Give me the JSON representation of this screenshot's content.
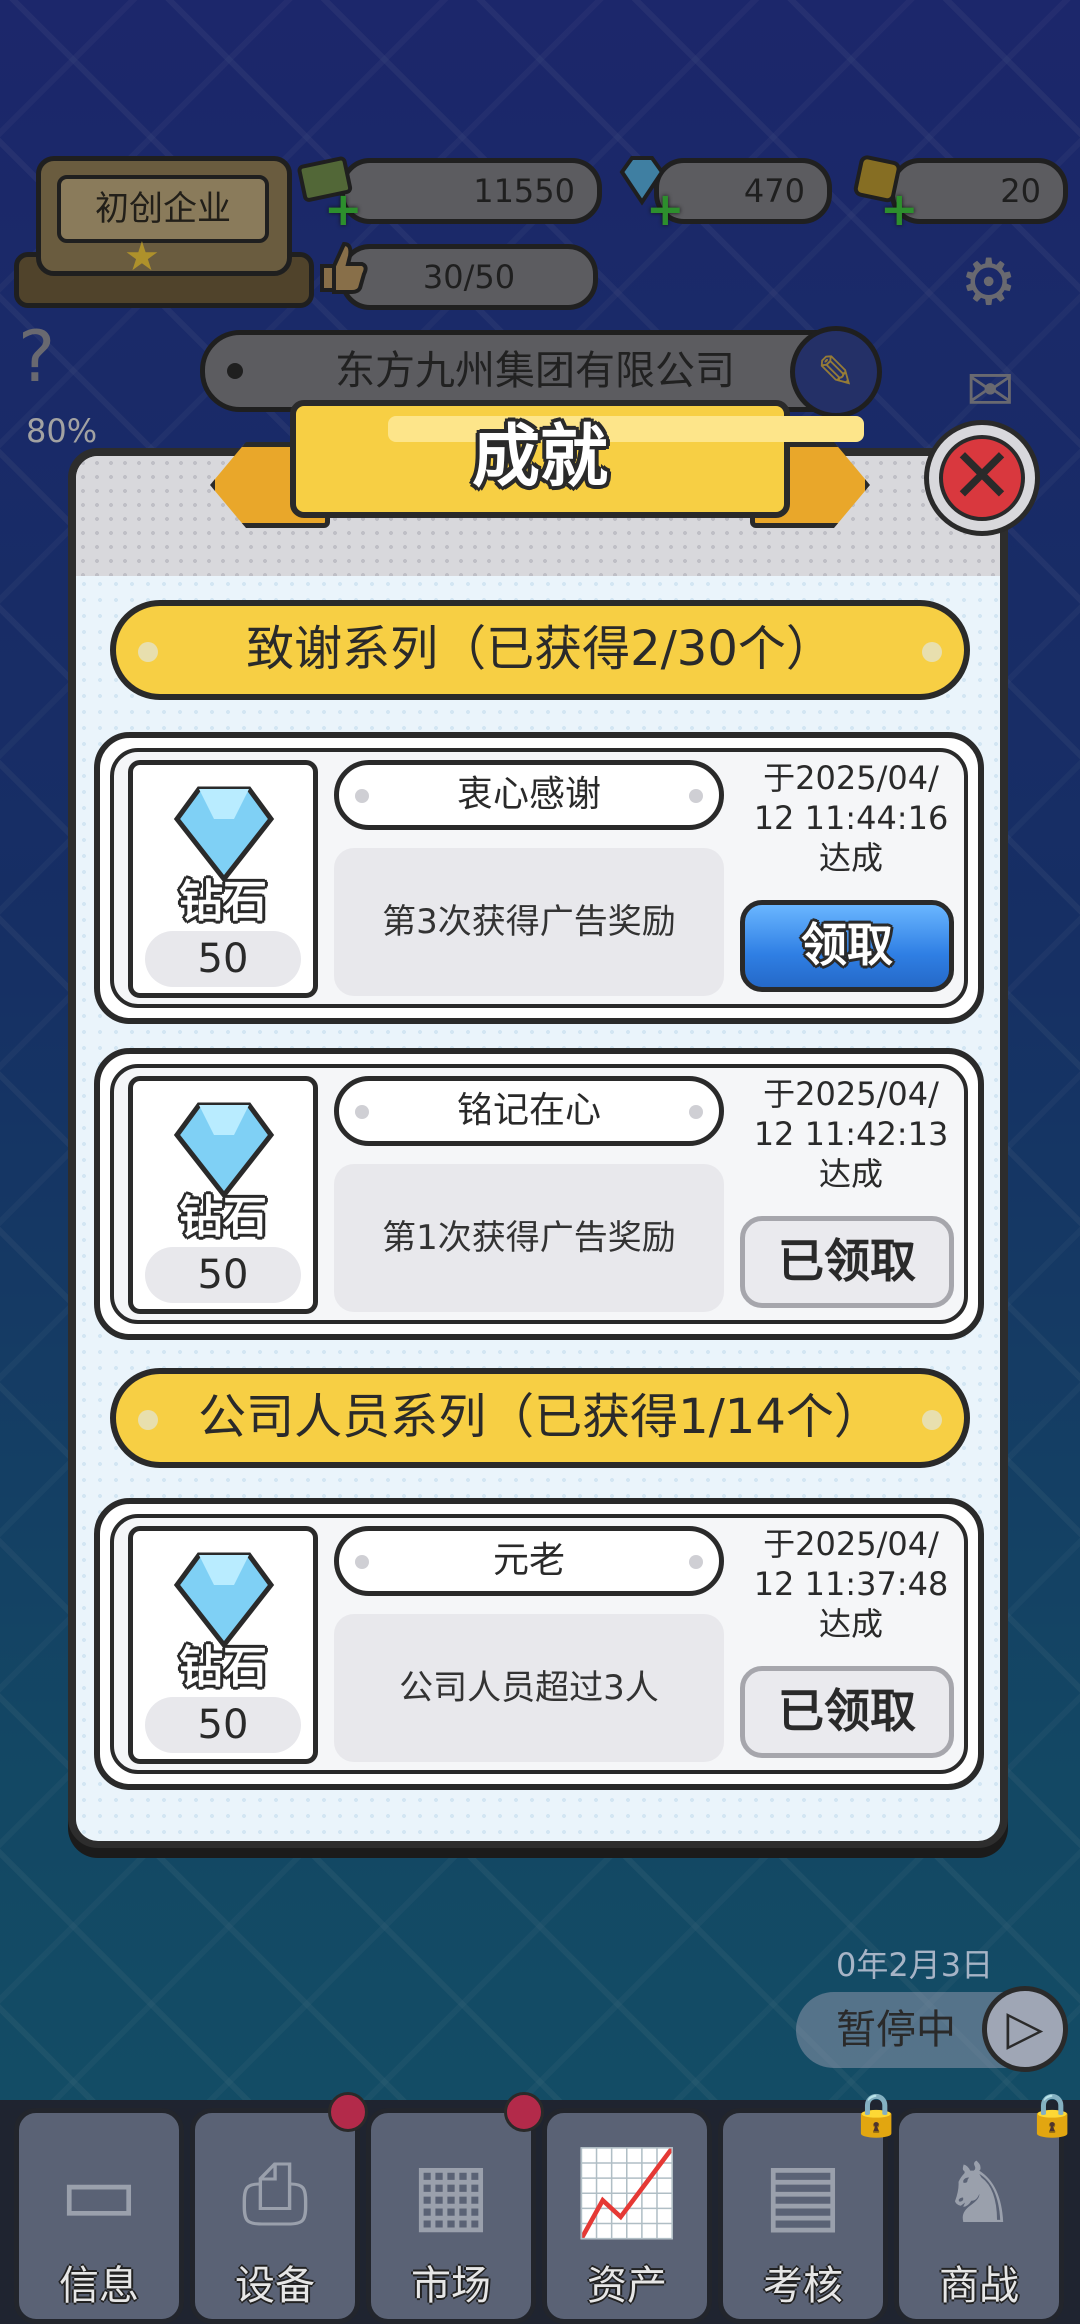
{
  "hud": {
    "company_level": "初创企业",
    "money": "11550",
    "diamonds": "470",
    "tickets": "20",
    "likes": "30/50",
    "company_name": "东方九州集团有限公司",
    "help_percent": "80%"
  },
  "modal": {
    "title": "成就",
    "sections": [
      {
        "heading": "致谢系列（已获得2/30个）",
        "items": [
          {
            "reward_name": "钻石",
            "reward_amount": "50",
            "title": "衷心感谢",
            "description": "第3次获得广告奖励",
            "date_line1": "于2025/04/",
            "date_line2": "12 11:44:16",
            "date_line3": "达成",
            "button": "领取",
            "button_state": "claimable"
          },
          {
            "reward_name": "钻石",
            "reward_amount": "50",
            "title": "铭记在心",
            "description": "第1次获得广告奖励",
            "date_line1": "于2025/04/",
            "date_line2": "12 11:42:13",
            "date_line3": "达成",
            "button": "已领取",
            "button_state": "claimed"
          }
        ]
      },
      {
        "heading": "公司人员系列（已获得1/14个）",
        "items": [
          {
            "reward_name": "钻石",
            "reward_amount": "50",
            "title": "元老",
            "description": "公司人员超过3人",
            "date_line1": "于2025/04/",
            "date_line2": "12 11:37:48",
            "date_line3": "达成",
            "button": "已领取",
            "button_state": "claimed"
          }
        ]
      }
    ]
  },
  "game_date": "0年2月3日",
  "pause_label": "暂停中",
  "nav": [
    "信息",
    "设备",
    "市场",
    "资产",
    "考核",
    "商战"
  ],
  "colors": {
    "accent_yellow": "#f7cf44",
    "claim_blue": "#2f7fe4",
    "close_red": "#d9383e"
  }
}
